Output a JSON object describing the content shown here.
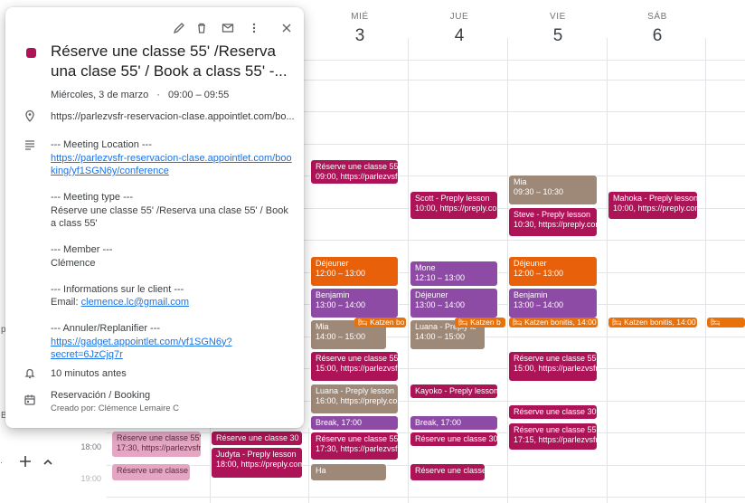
{
  "days": [
    {
      "name": "MIÉ",
      "num": "3"
    },
    {
      "name": "JUE",
      "num": "4"
    },
    {
      "name": "VIE",
      "num": "5"
    },
    {
      "name": "SÁB",
      "num": "6"
    }
  ],
  "time_labels": {
    "t18": "18:00",
    "t19": "19:00"
  },
  "left_partial": {
    "p": "p",
    "b": "B"
  },
  "events": {
    "wed_reserve_0900": {
      "title": "Réserve une classe 55'",
      "sub": "09:00, https://parlezvsfr"
    },
    "wed_dejeuner": {
      "title": "Déjeuner",
      "sub": "12:00 – 13:00"
    },
    "wed_benjamin": {
      "title": "Benjamin",
      "sub": "13:00 – 14:00"
    },
    "wed_mia": {
      "title": "Mia",
      "sub": "14:00 – 15:00"
    },
    "wed_reserve_1500": {
      "title": "Réserve une classe 55'",
      "sub": "15:00, https://parlezvsfr"
    },
    "wed_luana": {
      "title": "Luana - Preply lesson",
      "sub": "16:00, https://preply.com"
    },
    "wed_break": {
      "title": "Break, 17:00"
    },
    "wed_reserve_1730": {
      "title": "Réserve une classe 55'",
      "sub": "17:30, https://parlezvsfr"
    },
    "wed_ha": {
      "title": "Ha"
    },
    "tue_reserve_1730": {
      "title": "Réserve une classe 30",
      "sub": ""
    },
    "tue_judyta": {
      "title": "Judyta - Preply lesson",
      "sub": "18:00, https://preply.com"
    },
    "mon_reserve_1730": {
      "title": "Réserve une classe 55'",
      "sub": "17:30, https://parlezvsfr"
    },
    "mon_reserve_bottom": {
      "title": "Réserve une classe"
    },
    "thu_scott": {
      "title": "Scott - Preply lesson",
      "sub": "10:00, https://preply.com"
    },
    "thu_mone": {
      "title": "Mone",
      "sub": "12:10 – 13:00"
    },
    "thu_dejeuner": {
      "title": "Déjeuner",
      "sub": "13:00 – 14:00"
    },
    "thu_luana": {
      "title": "Luana - Preply le",
      "sub": "14:00 – 15:00"
    },
    "thu_kayoko": {
      "title": "Kayoko - Preply lesson,"
    },
    "thu_break": {
      "title": "Break, 17:00"
    },
    "thu_reserve_30": {
      "title": "Réserve une classe 30"
    },
    "thu_reserve_bottom": {
      "title": "Réserve une classe"
    },
    "fri_mia": {
      "title": "Mia",
      "sub": "09:30 – 10:30"
    },
    "fri_steve": {
      "title": "Steve - Preply lesson",
      "sub": "10:30, https://preply.com"
    },
    "fri_dejeuner": {
      "title": "Déjeuner",
      "sub": "12:00 – 13:00"
    },
    "fri_benjamin": {
      "title": "Benjamin",
      "sub": "13:00 – 14:00"
    },
    "fri_reserve_1500": {
      "title": "Réserve une classe 55'",
      "sub": "15:00, https://parlezvsfr"
    },
    "fri_reserve_30": {
      "title": "Réserve une classe 30"
    },
    "fri_reserve_1715": {
      "title": "Réserve une classe 55'",
      "sub": "17:15, https://parlezvsfr"
    },
    "sat_mahoka": {
      "title": "Mahoka - Preply lesson",
      "sub": "10:00, https://preply.com"
    }
  },
  "chips": {
    "wed": "🛏 Katzen bo",
    "thu": "🛏 Katzen b",
    "fri": "🛏 Katzen bonitis, 14:00",
    "sat": "🛏 Katzen bonitis, 14:00",
    "sun": "🛏"
  },
  "popup": {
    "title": "Réserve une classe 55' /Reserva una clase 55' / Book a class 55' -...",
    "date": "Miércoles, 3 de marzo",
    "dot": "·",
    "time": "09:00 – 09:55",
    "location": "https://parlezvsfr-reservacion-clase.appointlet.com/bo...",
    "meeting_location_hdr": "--- Meeting Location ---",
    "meeting_link": "https://parlezvsfr-reservacion-clase.appointlet.com/booking/yf1SGN6y/conference",
    "meeting_type_hdr": "--- Meeting type ---",
    "meeting_type": "Réserve une classe 55' /Reserva una clase 55' / Book a class 55'",
    "member_hdr": "--- Member ---",
    "member": "Clémence",
    "client_hdr": "--- Informations sur le client ---",
    "email_label": "Email:",
    "email": "clemence.lc@gmail.com",
    "reschedule_hdr": "--- Annuler/Replanifier ---",
    "reschedule_link": "https://gadget.appointlet.com/yf1SGN6y?secret=6JzCjq7r",
    "reminder": "10 minutos antes",
    "calendar": "Reservación / Booking",
    "creator": "Creado por: Clémence Lemaire C"
  },
  "icons": {
    "edit": "edit-icon",
    "delete": "delete-icon",
    "email": "email-icon",
    "more": "more-vert-icon",
    "close": "close-icon",
    "location": "location-icon",
    "description": "notes-icon",
    "reminder": "bell-icon",
    "calendar": "calendar-icon",
    "add": "add-icon",
    "collapse": "chevron-up-icon"
  },
  "colors": {
    "magenta": "#ad1457",
    "orange": "#e8600a",
    "purple": "#8e4ba5",
    "grey": "#9e8878",
    "link": "#1a73e8"
  }
}
